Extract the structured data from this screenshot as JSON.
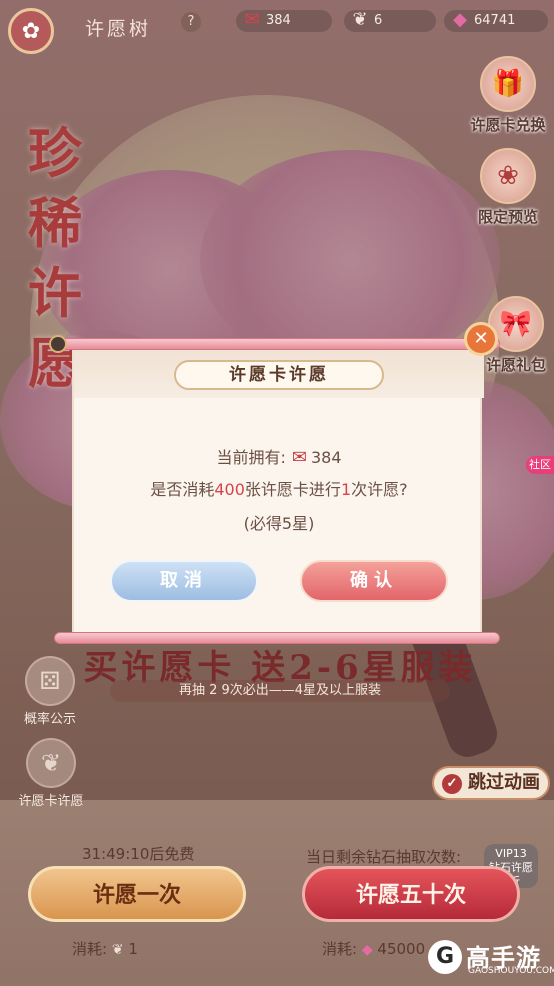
{
  "header": {
    "back_icon": "fan-icon",
    "title": "许愿树",
    "help": "?"
  },
  "resources": [
    {
      "icon": "wish-card-icon",
      "value": "384"
    },
    {
      "icon": "feather-icon",
      "value": "6"
    },
    {
      "icon": "diamond-icon",
      "value": "64741"
    }
  ],
  "left_title": [
    "珍",
    "稀",
    "许",
    "愿"
  ],
  "side_menu": [
    {
      "label": "许愿卡兑换",
      "icon": "gift-box-icon"
    },
    {
      "label": "限定预览",
      "icon": "fan-icon"
    },
    {
      "label": "许愿礼包",
      "icon": "gift-icon"
    }
  ],
  "community_label": "社区",
  "left_menu": [
    {
      "label": "概率公示",
      "icon": "dice-icon"
    },
    {
      "label": "许愿卡许愿",
      "icon": "tree-icon"
    }
  ],
  "promo": {
    "text": "买许愿卡 送2-6星服装",
    "sub": "再抽 2 9次必出——4星及以上服装"
  },
  "skip_animation": {
    "label": "跳过动画",
    "checked": true
  },
  "bottom": {
    "timer": "31:49:10后免费",
    "remaining": "当日剩余钻石抽取次数:",
    "vip_badge": "VIP13\n钻石许愿\n9折",
    "single_button": "许愿一次",
    "fifty_button": "许愿五十次",
    "single_cost_label": "消耗:",
    "single_cost_value": "1",
    "fifty_cost_label": "消耗:",
    "fifty_cost_value": "45000"
  },
  "dialog": {
    "title": "许愿卡许愿",
    "owned_label": "当前拥有:",
    "owned_value": "384",
    "question_prefix": "是否消耗",
    "question_amount": "400",
    "question_mid": "张许愿卡进行",
    "question_count": "1",
    "question_suffix": "次许愿?",
    "guarantee": "(必得5星)",
    "cancel": "取消",
    "confirm": "确认"
  },
  "watermark": {
    "logo": "G",
    "name": "高手游",
    "url": "GAOSHOUYOU.COM"
  }
}
